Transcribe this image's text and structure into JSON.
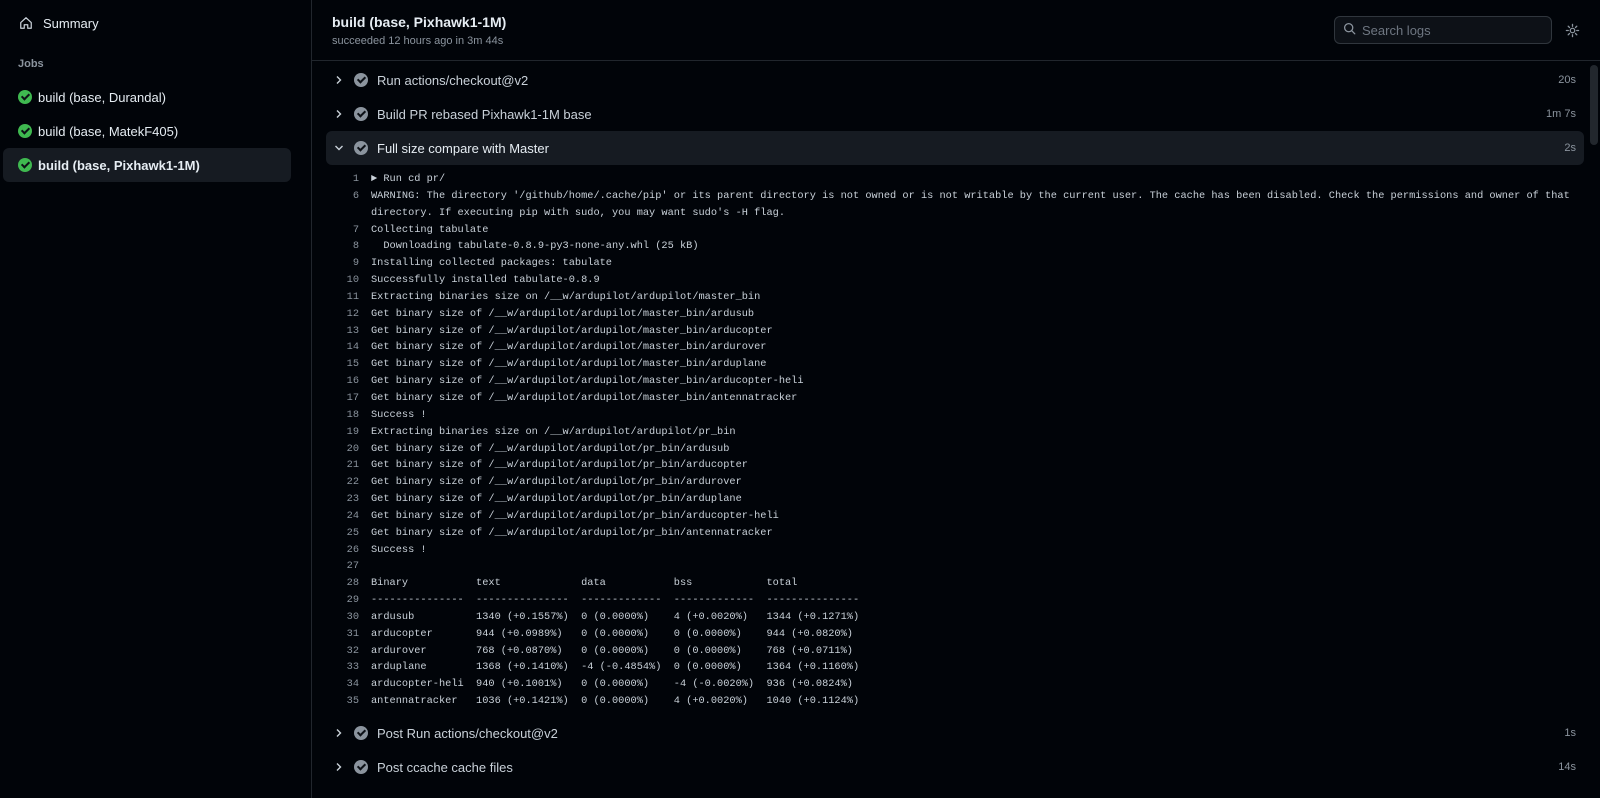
{
  "sidebar": {
    "summary_label": "Summary",
    "jobs_heading": "Jobs",
    "jobs": [
      {
        "label": "build (base, Durandal)"
      },
      {
        "label": "build (base, MatekF405)"
      },
      {
        "label": "build (base, Pixhawk1-1M)"
      }
    ]
  },
  "header": {
    "title": "build (base, Pixhawk1-1M)",
    "subtitle": "succeeded 12 hours ago in 3m 44s",
    "search_placeholder": "Search logs"
  },
  "steps_before": [
    {
      "name": "Run actions/checkout@v2",
      "duration": "20s"
    },
    {
      "name": "Build PR rebased Pixhawk1-1M base",
      "duration": "1m 7s"
    }
  ],
  "open_step": {
    "name": "Full size compare with Master",
    "duration": "2s"
  },
  "log_lines": [
    {
      "n": "1",
      "t": "► Run cd pr/"
    },
    {
      "n": "6",
      "t": "WARNING: The directory '/github/home/.cache/pip' or its parent directory is not owned or is not writable by the current user. The cache has been disabled. Check the permissions and owner of that directory. If executing pip with sudo, you may want sudo's -H flag."
    },
    {
      "n": "7",
      "t": "Collecting tabulate"
    },
    {
      "n": "8",
      "t": "  Downloading tabulate-0.8.9-py3-none-any.whl (25 kB)"
    },
    {
      "n": "9",
      "t": "Installing collected packages: tabulate"
    },
    {
      "n": "10",
      "t": "Successfully installed tabulate-0.8.9"
    },
    {
      "n": "11",
      "t": "Extracting binaries size on /__w/ardupilot/ardupilot/master_bin"
    },
    {
      "n": "12",
      "t": "Get binary size of /__w/ardupilot/ardupilot/master_bin/ardusub"
    },
    {
      "n": "13",
      "t": "Get binary size of /__w/ardupilot/ardupilot/master_bin/arducopter"
    },
    {
      "n": "14",
      "t": "Get binary size of /__w/ardupilot/ardupilot/master_bin/ardurover"
    },
    {
      "n": "15",
      "t": "Get binary size of /__w/ardupilot/ardupilot/master_bin/arduplane"
    },
    {
      "n": "16",
      "t": "Get binary size of /__w/ardupilot/ardupilot/master_bin/arducopter-heli"
    },
    {
      "n": "17",
      "t": "Get binary size of /__w/ardupilot/ardupilot/master_bin/antennatracker"
    },
    {
      "n": "18",
      "t": "Success !"
    },
    {
      "n": "19",
      "t": "Extracting binaries size on /__w/ardupilot/ardupilot/pr_bin"
    },
    {
      "n": "20",
      "t": "Get binary size of /__w/ardupilot/ardupilot/pr_bin/ardusub"
    },
    {
      "n": "21",
      "t": "Get binary size of /__w/ardupilot/ardupilot/pr_bin/arducopter"
    },
    {
      "n": "22",
      "t": "Get binary size of /__w/ardupilot/ardupilot/pr_bin/ardurover"
    },
    {
      "n": "23",
      "t": "Get binary size of /__w/ardupilot/ardupilot/pr_bin/arduplane"
    },
    {
      "n": "24",
      "t": "Get binary size of /__w/ardupilot/ardupilot/pr_bin/arducopter-heli"
    },
    {
      "n": "25",
      "t": "Get binary size of /__w/ardupilot/ardupilot/pr_bin/antennatracker"
    },
    {
      "n": "26",
      "t": "Success !"
    },
    {
      "n": "27",
      "t": ""
    },
    {
      "n": "28",
      "t": "Binary           text             data           bss            total"
    },
    {
      "n": "29",
      "t": "---------------  ---------------  -------------  -------------  ---------------"
    },
    {
      "n": "30",
      "t": "ardusub          1340 (+0.1557%)  0 (0.0000%)    4 (+0.0020%)   1344 (+0.1271%)"
    },
    {
      "n": "31",
      "t": "arducopter       944 (+0.0989%)   0 (0.0000%)    0 (0.0000%)    944 (+0.0820%)"
    },
    {
      "n": "32",
      "t": "ardurover        768 (+0.0870%)   0 (0.0000%)    0 (0.0000%)    768 (+0.0711%)"
    },
    {
      "n": "33",
      "t": "arduplane        1368 (+0.1410%)  -4 (-0.4854%)  0 (0.0000%)    1364 (+0.1160%)"
    },
    {
      "n": "34",
      "t": "arducopter-heli  940 (+0.1001%)   0 (0.0000%)    -4 (-0.0020%)  936 (+0.0824%)"
    },
    {
      "n": "35",
      "t": "antennatracker   1036 (+0.1421%)  0 (0.0000%)    4 (+0.0020%)   1040 (+0.1124%)"
    }
  ],
  "steps_after": [
    {
      "name": "Post Run actions/checkout@v2",
      "duration": "1s"
    },
    {
      "name": "Post ccache cache files",
      "duration": "14s"
    }
  ],
  "colors": {
    "success": "#3fb950",
    "neutral": "#8b949e",
    "bg": "#010409"
  }
}
